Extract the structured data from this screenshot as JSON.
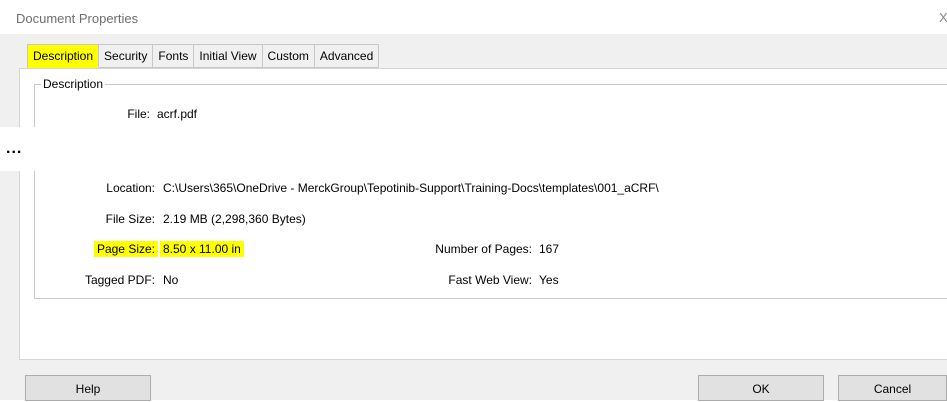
{
  "window": {
    "title": "Document Properties",
    "close_glyph": "X"
  },
  "tabs": [
    {
      "label": "Description",
      "active": true
    },
    {
      "label": "Security"
    },
    {
      "label": "Fonts"
    },
    {
      "label": "Initial View"
    },
    {
      "label": "Custom"
    },
    {
      "label": "Advanced"
    }
  ],
  "description_group": {
    "legend": "Description",
    "file_label": "File:",
    "file_value": "acrf.pdf"
  },
  "ellipsis": "...",
  "advanced": {
    "location_label": "Location:",
    "location_value": "C:\\Users\\365\\OneDrive - MerckGroup\\Tepotinib-Support\\Training-Docs\\templates\\001_aCRF\\",
    "file_size_label": "File Size:",
    "file_size_value": "2.19 MB (2,298,360 Bytes)",
    "page_size_label": "Page Size:",
    "page_size_value": "8.50 x 11.00 in",
    "num_pages_label": "Number of Pages:",
    "num_pages_value": "167",
    "tagged_pdf_label": "Tagged PDF:",
    "tagged_pdf_value": "No",
    "fast_web_label": "Fast Web View:",
    "fast_web_value": "Yes"
  },
  "buttons": {
    "help": "Help",
    "ok": "OK",
    "cancel": "Cancel"
  },
  "colors": {
    "highlight": "#ffff00",
    "dialog_bg": "#f0f0f0"
  }
}
